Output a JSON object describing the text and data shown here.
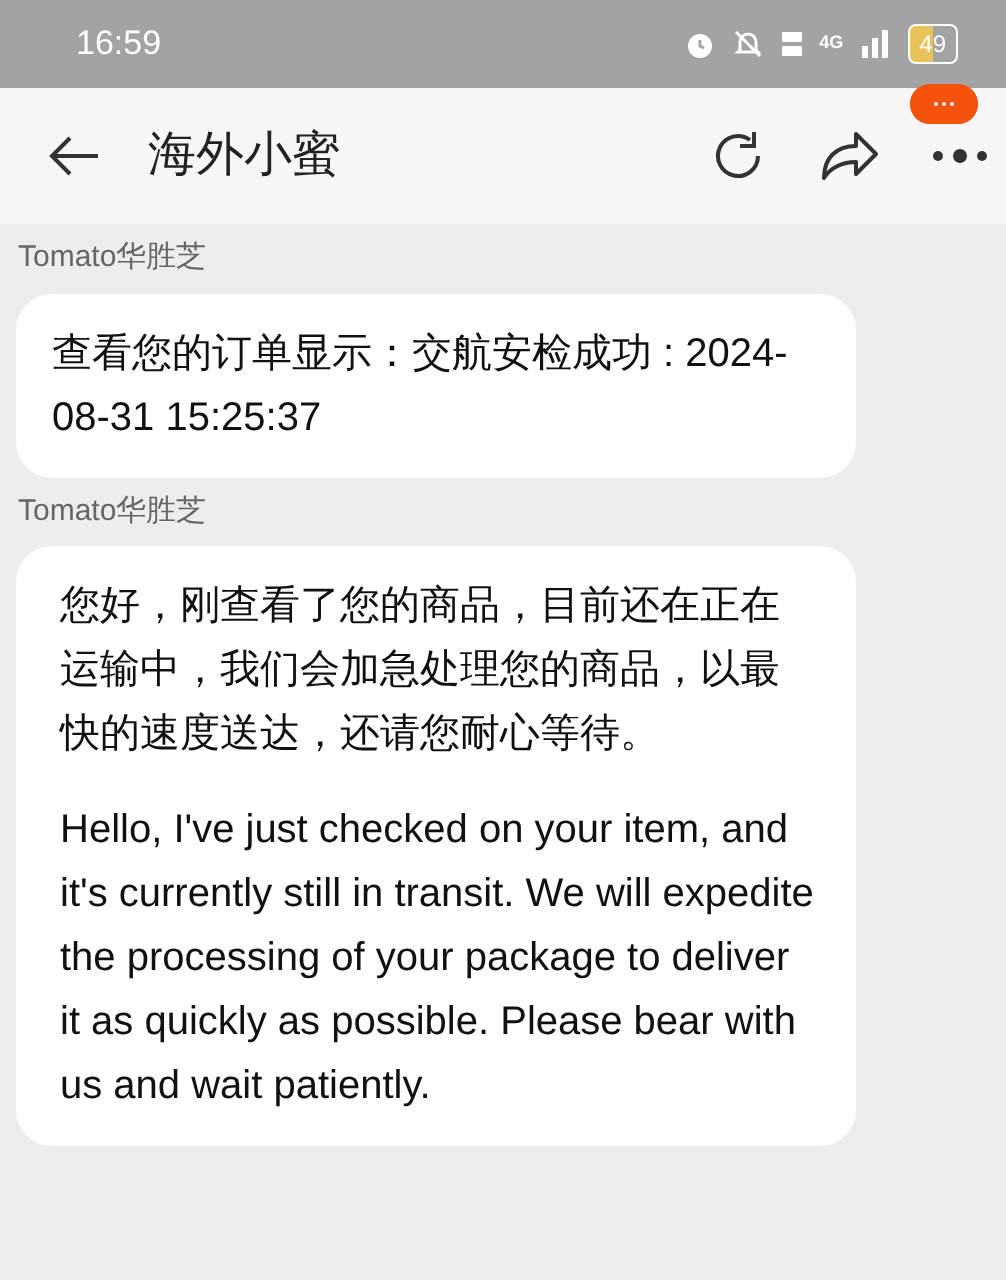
{
  "status_bar": {
    "time": "16:59",
    "network": "4G",
    "battery": "49"
  },
  "header": {
    "title": "海外小蜜"
  },
  "messages": [
    {
      "sender": "Tomato华胜芝",
      "paragraphs": [
        "查看您的订单显示：交航安检成功 : 2024-08-31 15:25:37"
      ]
    },
    {
      "sender": "Tomato华胜芝",
      "paragraphs": [
        "您好，刚查看了您的商品，目前还在正在运输中，我们会加急处理您的商品，以最快的速度送达，还请您耐心等待。",
        "Hello, I've just checked on your item, and it's currently still in transit. We will expedite the processing of your package to deliver it as quickly as possible. Please bear with us and wait patiently."
      ]
    }
  ]
}
